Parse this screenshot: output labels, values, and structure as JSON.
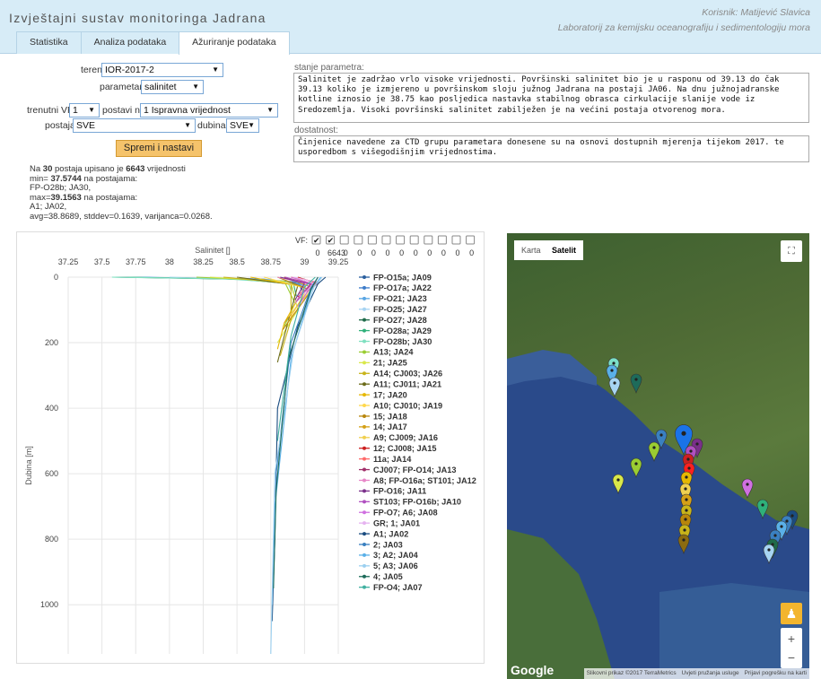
{
  "header": {
    "title": "Izvještajni sustav monitoringa Jadrana",
    "user": "Korisnik: Matijević Slavica",
    "lab": "Laboratorij za kemijsku oceanografiju i sedimentologiju mora"
  },
  "tabs": [
    "Statistika",
    "Analiza podataka",
    "Ažuriranje podataka"
  ],
  "form": {
    "teren_label": "teren:",
    "teren_value": "IOR-2017-2",
    "parametar_label": "parametar:",
    "parametar_value": "salinitet",
    "vf_label": "trenutni VF :",
    "vf_value": "1",
    "postavi_label": "postavi na:",
    "postavi_value": "1 Ispravna vrijednost",
    "postaja_label": "postaja:",
    "postaja_value": "SVE",
    "dubina_label": "dubina:",
    "dubina_value": "SVE",
    "save_label": "Spremi i nastavi"
  },
  "stats": {
    "line1_pre": "Na ",
    "count_stations": "30",
    "line1_mid": " postaja upisano je ",
    "count_values": "6643",
    "line1_post": " vrijednosti",
    "min_pre": "min= ",
    "min_val": "37.5744",
    "min_post": " na postajama:",
    "min_stations": "FP-O28b; JA30,",
    "max_pre": "max=",
    "max_val": "39.1563",
    "max_post": " na postajama:",
    "max_stations": "A1; JA02,",
    "avg": "avg=38.8689, stddev=0.1639, varijanca=0.0268."
  },
  "stanje": {
    "label": "stanje parametra:",
    "text": "Salinitet je zadržao vrlo visoke vrijednosti. Površinski salinitet bio je u rasponu od 39.13 do čak 39.13 koliko je izmjereno u površinskom sloju južnog Jadrana na postaji JA06. Na dnu južnojadranske kotline iznosio je 38.75 kao posljedica nastavka stabilnog obrasca cirkulacije slanije vode iz Sredozemlja. Visoki površinski salinitet zabilježen je na većini postaja otvorenog mora."
  },
  "dostatnost": {
    "label": "dostatnost:",
    "text": "Činjenice navedene za CTD grupu parametara donesene su na osnovi dostupnih mjerenja tijekom 2017. te usporedbom s višegodišnjim vrijednostima."
  },
  "vf": {
    "label": "VF:",
    "counts": [
      "0",
      "6643",
      "0",
      "0",
      "0",
      "0",
      "0",
      "0",
      "0",
      "0",
      "0",
      "0"
    ],
    "checked": [
      true,
      true,
      false,
      false,
      false,
      false,
      false,
      false,
      false,
      false,
      false,
      false
    ]
  },
  "chart_data": {
    "type": "line",
    "title": "Salinitet []",
    "xlabel": "Salinitet []",
    "ylabel": "Dubina [m]",
    "x_ticks": [
      "37.25",
      "37.5",
      "37.75",
      "38",
      "38.25",
      "38.5",
      "38.75",
      "39",
      "39.25"
    ],
    "y_ticks": [
      "0",
      "200",
      "400",
      "600",
      "800",
      "1000"
    ],
    "xlim": [
      37.25,
      39.25
    ],
    "ylim": [
      0,
      1150
    ],
    "grid": true,
    "legend_position": "right",
    "series": [
      {
        "name": "FP-O15a; JA09",
        "color": "#2a5f9e",
        "points": [
          [
            37.6,
            0
          ],
          [
            38.6,
            5
          ],
          [
            38.95,
            15
          ],
          [
            38.98,
            40
          ]
        ]
      },
      {
        "name": "FP-O17a; JA22",
        "color": "#3d7cc9",
        "points": [
          [
            37.7,
            0
          ],
          [
            38.7,
            6
          ],
          [
            38.97,
            20
          ],
          [
            38.99,
            45
          ]
        ]
      },
      {
        "name": "FP-O21; JA23",
        "color": "#5aa6e3",
        "points": [
          [
            37.8,
            0
          ],
          [
            38.75,
            8
          ],
          [
            39.0,
            25
          ],
          [
            38.98,
            55
          ]
        ]
      },
      {
        "name": "FP-O25; JA27",
        "color": "#a7d4f2",
        "points": [
          [
            38.0,
            0
          ],
          [
            38.8,
            10
          ],
          [
            39.0,
            30
          ],
          [
            38.95,
            60
          ]
        ]
      },
      {
        "name": "FP-O27; JA28",
        "color": "#1f6b4a",
        "points": [
          [
            37.6,
            0
          ],
          [
            38.5,
            6
          ],
          [
            38.9,
            20
          ],
          [
            38.92,
            50
          ]
        ]
      },
      {
        "name": "FP-O28a; JA29",
        "color": "#2fb07a",
        "points": [
          [
            37.7,
            0
          ],
          [
            38.6,
            7
          ],
          [
            38.92,
            22
          ],
          [
            38.94,
            58
          ]
        ]
      },
      {
        "name": "FP-O28b; JA30",
        "color": "#7fe0c0",
        "points": [
          [
            37.5744,
            0
          ],
          [
            38.4,
            5
          ],
          [
            38.88,
            18
          ],
          [
            38.9,
            40
          ]
        ]
      },
      {
        "name": "A13; JA24",
        "color": "#9acd32",
        "points": [
          [
            38.2,
            0
          ],
          [
            38.85,
            12
          ],
          [
            38.93,
            80
          ],
          [
            38.85,
            150
          ]
        ]
      },
      {
        "name": "21; JA25",
        "color": "#d9e84a",
        "points": [
          [
            38.3,
            0
          ],
          [
            38.9,
            15
          ],
          [
            38.95,
            100
          ],
          [
            38.8,
            200
          ]
        ]
      },
      {
        "name": "A14; CJ003; JA26",
        "color": "#c8b41a",
        "points": [
          [
            38.4,
            0
          ],
          [
            38.9,
            20
          ],
          [
            38.9,
            130
          ],
          [
            38.82,
            240
          ]
        ]
      },
      {
        "name": "A11; CJ011; JA21",
        "color": "#6b6b1a",
        "points": [
          [
            38.5,
            0
          ],
          [
            38.95,
            25
          ],
          [
            38.85,
            180
          ],
          [
            38.8,
            260
          ]
        ]
      },
      {
        "name": "17; JA20",
        "color": "#e6b800",
        "points": [
          [
            38.6,
            0
          ],
          [
            39.0,
            30
          ],
          [
            38.85,
            140
          ],
          [
            38.8,
            220
          ]
        ]
      },
      {
        "name": "A10; CJ010; JA19",
        "color": "#ffd84d",
        "points": [
          [
            38.7,
            0
          ],
          [
            39.02,
            35
          ],
          [
            38.86,
            150
          ]
        ]
      },
      {
        "name": "15; JA18",
        "color": "#b8860b",
        "points": [
          [
            38.8,
            0
          ],
          [
            39.05,
            40
          ],
          [
            38.84,
            160
          ]
        ]
      },
      {
        "name": "14; JA17",
        "color": "#d4a017",
        "points": [
          [
            38.85,
            0
          ],
          [
            39.05,
            30
          ],
          [
            38.85,
            140
          ]
        ]
      },
      {
        "name": "A9; CJ009; JA16",
        "color": "#f0d050",
        "points": [
          [
            38.9,
            0
          ],
          [
            39.08,
            25
          ],
          [
            38.88,
            120
          ]
        ]
      },
      {
        "name": "12; CJ008; JA15",
        "color": "#cc2020",
        "points": [
          [
            38.95,
            0
          ],
          [
            39.1,
            20
          ],
          [
            38.95,
            60
          ]
        ]
      },
      {
        "name": "11a; JA14",
        "color": "#ff6a6a",
        "points": [
          [
            38.9,
            0
          ],
          [
            39.1,
            15
          ],
          [
            38.96,
            50
          ]
        ]
      },
      {
        "name": "CJ007; FP-O14; JA13",
        "color": "#a0306a",
        "points": [
          [
            38.85,
            0
          ],
          [
            39.05,
            20
          ],
          [
            38.95,
            70
          ]
        ]
      },
      {
        "name": "A8; FP-O16a; ST101; JA12",
        "color": "#e887c8",
        "points": [
          [
            38.8,
            0
          ],
          [
            39.02,
            20
          ],
          [
            38.93,
            80
          ]
        ]
      },
      {
        "name": "FP-O16; JA11",
        "color": "#7a2f8a",
        "points": [
          [
            38.82,
            0
          ],
          [
            39.0,
            18
          ],
          [
            38.93,
            70
          ]
        ]
      },
      {
        "name": "ST103; FP-O16b; JA10",
        "color": "#b04fc0",
        "points": [
          [
            38.86,
            0
          ],
          [
            39.04,
            22
          ],
          [
            38.94,
            75
          ]
        ]
      },
      {
        "name": "FP-O7; A6; JA08",
        "color": "#d070e0",
        "points": [
          [
            38.9,
            0
          ],
          [
            39.06,
            20
          ],
          [
            38.95,
            90
          ]
        ]
      },
      {
        "name": "GR; 1; JA01",
        "color": "#e6b3f0",
        "points": [
          [
            38.92,
            0
          ],
          [
            39.08,
            15
          ],
          [
            38.97,
            60
          ]
        ]
      },
      {
        "name": "A1; JA02",
        "color": "#1a4c80",
        "points": [
          [
            39.1563,
            0
          ],
          [
            39.1,
            20
          ],
          [
            38.95,
            150
          ],
          [
            38.8,
            400
          ],
          [
            38.78,
            800
          ],
          [
            38.76,
            1050
          ]
        ]
      },
      {
        "name": "2; JA03",
        "color": "#3a80c0",
        "points": [
          [
            39.1,
            0
          ],
          [
            39.05,
            30
          ],
          [
            38.9,
            200
          ],
          [
            38.79,
            600
          ],
          [
            38.77,
            900
          ]
        ]
      },
      {
        "name": "3; A2; JA04",
        "color": "#5ab0e8",
        "points": [
          [
            39.12,
            0
          ],
          [
            39.05,
            40
          ],
          [
            38.9,
            250
          ],
          [
            38.78,
            700
          ],
          [
            38.76,
            1000
          ]
        ]
      },
      {
        "name": "5; A3; JA06",
        "color": "#9cd0f0",
        "points": [
          [
            39.13,
            0
          ],
          [
            39.07,
            30
          ],
          [
            38.92,
            220
          ],
          [
            38.78,
            600
          ],
          [
            38.75,
            1150
          ]
        ]
      },
      {
        "name": "4; JA05",
        "color": "#1d6b5a",
        "points": [
          [
            39.1,
            0
          ],
          [
            39.05,
            35
          ],
          [
            38.88,
            250
          ],
          [
            38.79,
            650
          ],
          [
            38.77,
            950
          ]
        ]
      },
      {
        "name": "FP-O4; JA07",
        "color": "#40b0a0",
        "points": [
          [
            39.08,
            0
          ],
          [
            39.0,
            30
          ],
          [
            38.9,
            180
          ],
          [
            38.8,
            500
          ]
        ]
      }
    ]
  },
  "map": {
    "tab_karta": "Karta",
    "tab_satelit": "Satelit",
    "google": "Google",
    "attrib1": "Slikovni prikaz ©2017 TerraMetrics",
    "attrib2": "Uvjeti pružanja usluge",
    "attrib3": "Prijavi pogrešku na karti",
    "zoom_in": "+",
    "zoom_out": "−"
  }
}
